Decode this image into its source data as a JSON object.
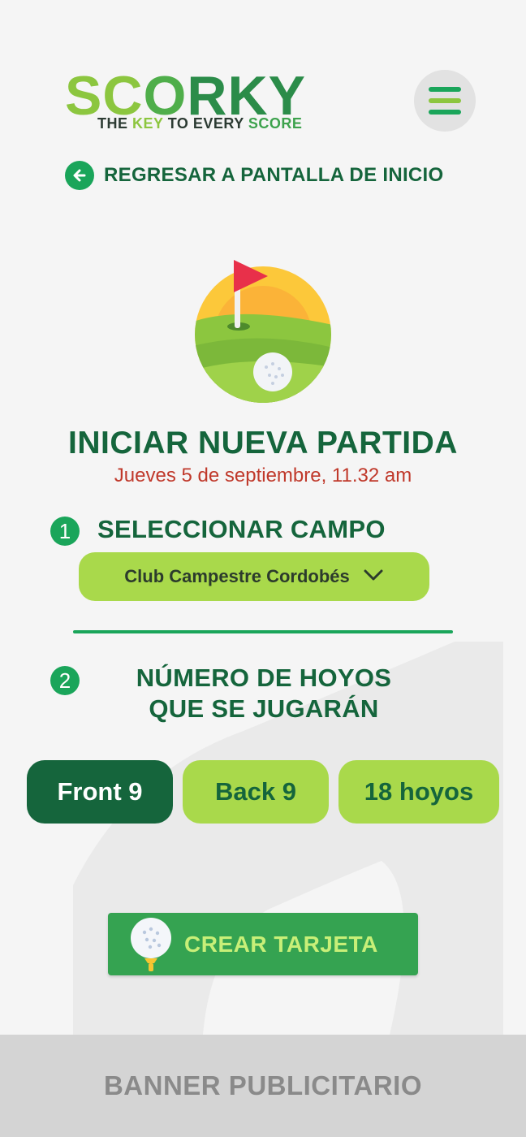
{
  "brand": {
    "logo_parts": [
      "SC",
      "O",
      "RKY"
    ],
    "tagline_parts": [
      "THE ",
      "KEY",
      " TO EVERY ",
      "SCORE"
    ]
  },
  "nav": {
    "back_label": "REGRESAR A PANTALLA DE INICIO",
    "back_icon": "arrow-left-icon",
    "menu_icon": "hamburger-menu-icon"
  },
  "hero": {
    "icon": "golf-flag-ball-icon"
  },
  "game": {
    "title": "INICIAR NUEVA PARTIDA",
    "date": "Jueves 5 de septiembre, 11.32 am"
  },
  "step1": {
    "number": "1",
    "label": "SELECCIONAR CAMPO",
    "selected_course": "Club Campestre Cordobés",
    "dropdown_icon": "chevron-down-icon"
  },
  "step2": {
    "number": "2",
    "label_line1": "NÚMERO DE HOYOS",
    "label_line2": "QUE SE JUGARÁN",
    "options": [
      {
        "label": "Front 9",
        "selected": true
      },
      {
        "label": "Back 9",
        "selected": false
      },
      {
        "label": "18 hoyos",
        "selected": false
      }
    ]
  },
  "create": {
    "label": "CREAR TARJETA",
    "icon": "golf-ball-tee-icon"
  },
  "banner": {
    "label": "BANNER PUBLICITARIO"
  },
  "colors": {
    "dark_green": "#15653c",
    "accent_green": "#1aa55a",
    "lime": "#a9d94b",
    "date_red": "#c0392b",
    "button_green": "#35a351",
    "banner_gray": "#d4d4d4"
  }
}
